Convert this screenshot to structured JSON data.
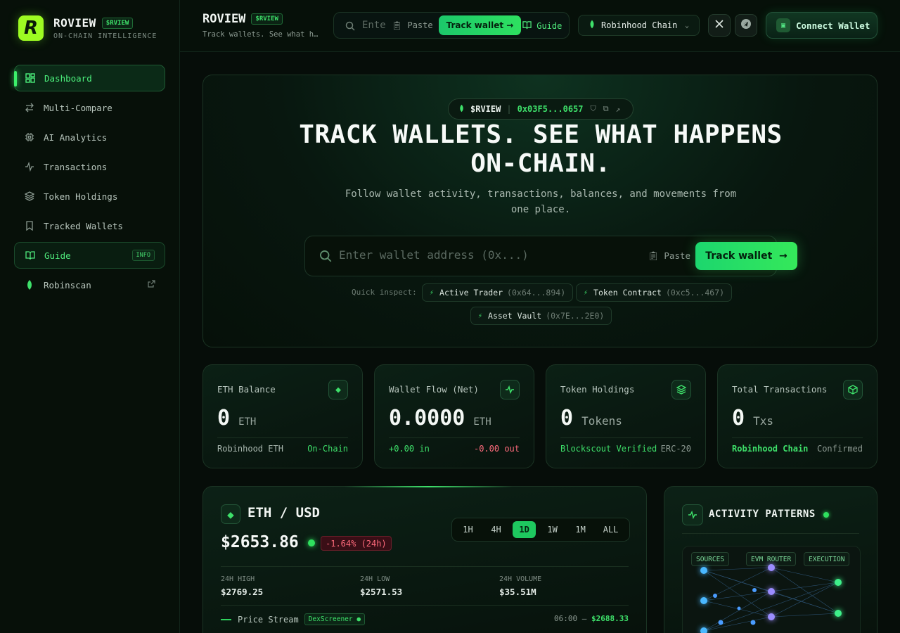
{
  "brand": {
    "name": "ROVIEW",
    "token": "$RVIEW",
    "tagline": "ON-CHAIN INTELLIGENCE",
    "logo_letter": "R"
  },
  "sidebar": {
    "items": [
      {
        "label": "Dashboard",
        "icon": "dashboard-icon"
      },
      {
        "label": "Multi-Compare",
        "icon": "compare-arrows-icon"
      },
      {
        "label": "AI Analytics",
        "icon": "cpu-icon"
      },
      {
        "label": "Transactions",
        "icon": "activity-icon"
      },
      {
        "label": "Token Holdings",
        "icon": "layers-icon"
      },
      {
        "label": "Tracked Wallets",
        "icon": "bookmark-icon"
      },
      {
        "label": "Guide",
        "icon": "book-icon",
        "badge": "INFO"
      },
      {
        "label": "Robinscan",
        "icon": "leaf-icon"
      }
    ]
  },
  "header": {
    "title": "ROVIEW",
    "token": "$RVIEW",
    "subtitle": "Track wallets. See what happens on-chain.",
    "search_placeholder": "Enter wallet address",
    "paste_label": "Paste",
    "track_label": "Track wallet",
    "guide_label": "Guide",
    "chain_label": "Robinhood Chain",
    "connect_label": "Connect Wallet"
  },
  "hero": {
    "token": "$RVIEW",
    "contract": "0x03F5...0657",
    "headline": "TRACK WALLETS. SEE WHAT HAPPENS ON-CHAIN.",
    "subline": "Follow wallet activity, transactions, balances, and movements from one place.",
    "search_placeholder": "Enter wallet address (0x...)",
    "paste_label": "Paste",
    "track_label": "Track wallet",
    "quick_label": "Quick inspect:",
    "quick": [
      {
        "name": "Active Trader",
        "addr": "(0x64...894)"
      },
      {
        "name": "Token Contract",
        "addr": "(0xc5...467)"
      },
      {
        "name": "Asset Vault",
        "addr": "(0x7E...2E0)"
      }
    ]
  },
  "cards": [
    {
      "label": "ETH Balance",
      "value": "0",
      "unit": "ETH",
      "foot_left": "Robinhood ETH",
      "foot_right": "On-Chain",
      "icon": "eth-icon"
    },
    {
      "label": "Wallet Flow (Net)",
      "value": "0.0000",
      "unit": "ETH",
      "foot_left": "+0.00 in",
      "foot_right": "-0.00 out",
      "icon": "pulse-icon"
    },
    {
      "label": "Token Holdings",
      "value": "0",
      "unit": "Tokens",
      "foot_left": "Blockscout Verified",
      "foot_right": "ERC-20",
      "icon": "layers-icon"
    },
    {
      "label": "Total Transactions",
      "value": "0",
      "unit": "Txs",
      "foot_left": "Robinhood Chain",
      "foot_right": "Confirmed",
      "icon": "cube-icon"
    }
  ],
  "price": {
    "pair": "ETH / USD",
    "value": "$2653.86",
    "change": "-1.64% (24h)",
    "timeframes": [
      "1H",
      "4H",
      "1D",
      "1W",
      "1M",
      "ALL"
    ],
    "active_timeframe": "1D",
    "high_label": "24H HIGH",
    "high": "$2769.25",
    "low_label": "24H LOW",
    "low": "$2571.53",
    "vol_label": "24H VOLUME",
    "vol": "$35.51M",
    "stream_label": "Price Stream",
    "source": "DexScreener",
    "stream_time": "06:00 —",
    "stream_value": "$2688.33"
  },
  "activity": {
    "title": "ACTIVITY PATTERNS",
    "labels": [
      "SOURCES",
      "EVM ROUTER",
      "EXECUTION"
    ]
  },
  "colors": {
    "accent": "#3ee06a",
    "negative": "#ff6b7c",
    "background": "#060d09"
  }
}
